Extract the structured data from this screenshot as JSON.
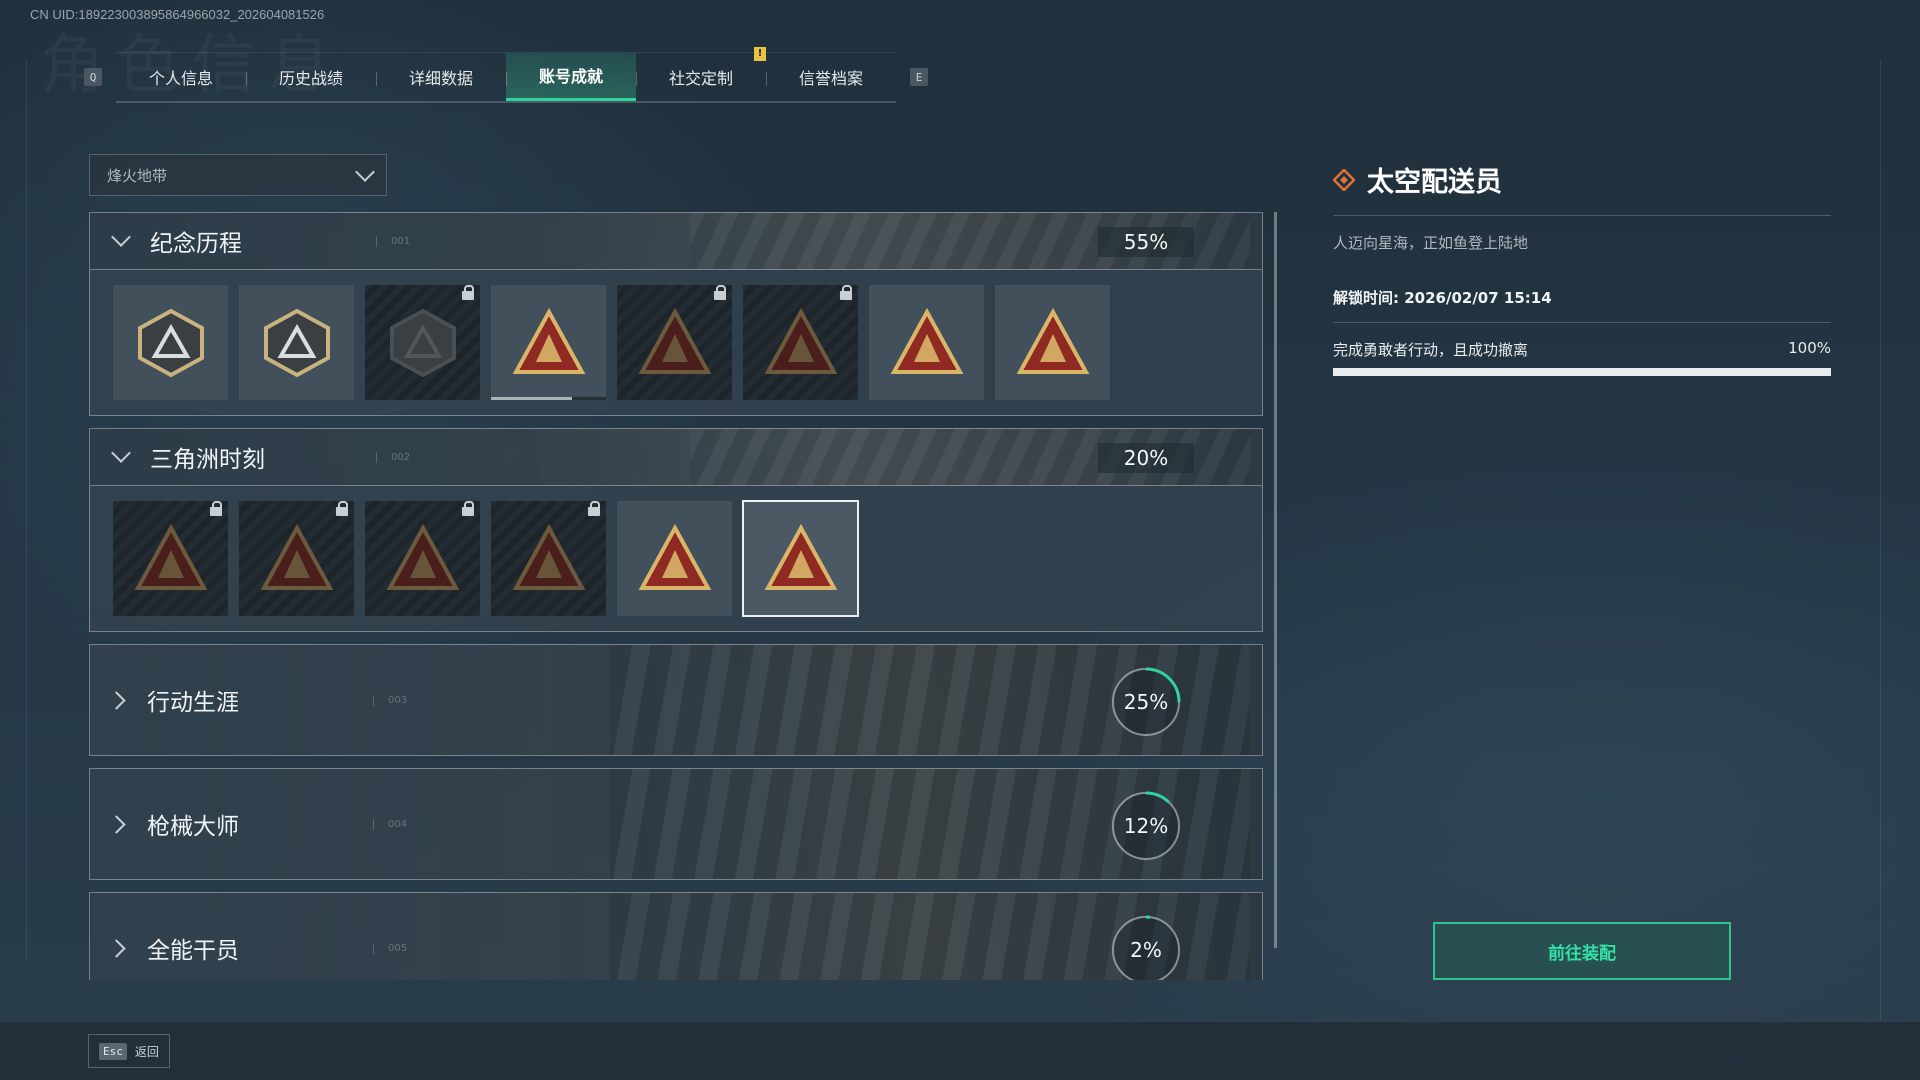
{
  "uid": "CN UID:189223003895864966032_202604081526",
  "ghost_title": "角色信息",
  "tabs": {
    "left_key": "Q",
    "right_key": "E",
    "items": [
      {
        "label": "个人信息"
      },
      {
        "label": "历史战绩"
      },
      {
        "label": "详细数据"
      },
      {
        "label": "账号成就",
        "active": true
      },
      {
        "label": "社交定制",
        "alert": "!"
      },
      {
        "label": "信誉档案"
      }
    ]
  },
  "mode_select": {
    "value": "烽火地带"
  },
  "categories": [
    {
      "name": "纪念历程",
      "index": "001",
      "percent": "55%",
      "expanded": true,
      "badges": [
        {
          "icon": "triangle-emblem-icon",
          "locked": false
        },
        {
          "icon": "helicopter-emblem-icon",
          "locked": false
        },
        {
          "icon": "dark-shield-emblem-icon",
          "locked": true
        },
        {
          "icon": "skull-58-emblem-icon",
          "locked": false,
          "progress": 0.7
        },
        {
          "icon": "hooded-figure-emblem-icon",
          "locked": true
        },
        {
          "icon": "crossed-swords-skull-emblem-icon",
          "locked": true
        },
        {
          "icon": "wings-emblem-icon",
          "locked": false
        },
        {
          "icon": "number-one-emblem-icon",
          "locked": false
        }
      ]
    },
    {
      "name": "三角洲时刻",
      "index": "002",
      "percent": "20%",
      "expanded": true,
      "badges": [
        {
          "icon": "robot-emblem-icon",
          "locked": true
        },
        {
          "icon": "mask-emblem-icon",
          "locked": true
        },
        {
          "icon": "kneeling-figure-emblem-icon",
          "locked": true
        },
        {
          "icon": "octopus-emblem-icon",
          "locked": true
        },
        {
          "icon": "soldiers-emblem-icon",
          "locked": false
        },
        {
          "icon": "rocket-emblem-icon",
          "locked": false,
          "selected": true
        }
      ]
    },
    {
      "name": "行动生涯",
      "index": "003",
      "percent": "25%",
      "value": 0.25,
      "expanded": false
    },
    {
      "name": "枪械大师",
      "index": "004",
      "percent": "12%",
      "value": 0.12,
      "expanded": false
    },
    {
      "name": "全能干员",
      "index": "005",
      "percent": "2%",
      "value": 0.02,
      "expanded": false
    }
  ],
  "detail": {
    "title": "太空配送员",
    "description": "人迈向星海，正如鱼登上陆地",
    "unlock_time": "解锁时间: 2026/02/07 15:14",
    "requirement": "完成勇敢者行动，且成功撤离",
    "requirement_percent": "100%",
    "requirement_value": 1.0
  },
  "equip_button": "前往装配",
  "back": {
    "key": "Esc",
    "label": "返回"
  },
  "colors": {
    "accent": "#2fd49b",
    "alert": "#e8c244",
    "emblem_gold": "#d9b56a",
    "emblem_red": "#8e2a22"
  }
}
